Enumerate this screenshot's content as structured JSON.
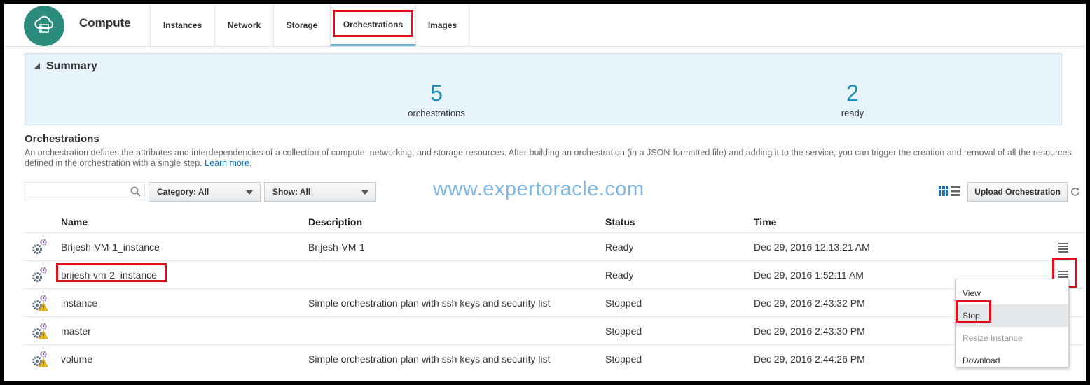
{
  "app": {
    "title": "Compute",
    "brand_color": "#2b8c7e"
  },
  "tabs": [
    {
      "label": "Instances"
    },
    {
      "label": "Network"
    },
    {
      "label": "Storage"
    },
    {
      "label": "Orchestrations",
      "active": true
    },
    {
      "label": "Images"
    }
  ],
  "summary": {
    "title": "Summary",
    "stats": [
      {
        "value": "5",
        "label": "orchestrations"
      },
      {
        "value": "2",
        "label": "ready"
      }
    ]
  },
  "section": {
    "title": "Orchestrations",
    "description": "An orchestration defines the attributes and interdependencies of a collection of compute, networking, and storage resources. After building an orchestration (in a JSON-formatted file) and adding it to the service, you can trigger the creation and removal of all the resources defined in the orchestration with a single step.",
    "learn_more": "Learn more."
  },
  "toolbar": {
    "search_value": "",
    "category_select": "Category: All",
    "show_select": "Show: All",
    "upload_label": "Upload Orchestration"
  },
  "watermark": "www.expertoracle.com",
  "table": {
    "columns": [
      "Name",
      "Description",
      "Status",
      "Time"
    ],
    "rows": [
      {
        "name": "Brijesh-VM-1_instance",
        "description": "Brijesh-VM-1",
        "status": "Ready",
        "time": "Dec 29, 2016 12:13:21 AM",
        "icon": "gears-icon"
      },
      {
        "name": "brijesh-vm-2_instance",
        "description": "",
        "status": "Ready",
        "time": "Dec 29, 2016 1:52:11 AM",
        "icon": "gears-icon"
      },
      {
        "name": "instance",
        "description": "Simple orchestration plan with ssh keys and security list",
        "status": "Stopped",
        "time": "Dec 29, 2016 2:43:32 PM",
        "icon": "gears-warning-icon"
      },
      {
        "name": "master",
        "description": "",
        "status": "Stopped",
        "time": "Dec 29, 2016 2:43:30 PM",
        "icon": "gears-warning-icon"
      },
      {
        "name": "volume",
        "description": "Simple orchestration plan with ssh keys and security list",
        "status": "Stopped",
        "time": "Dec 29, 2016 2:44:26 PM",
        "icon": "gears-warning-icon"
      }
    ]
  },
  "context_menu": {
    "items": [
      {
        "label": "View"
      },
      {
        "label": "Stop",
        "highlighted": true
      },
      {
        "label": "Resize Instance",
        "disabled": true
      },
      {
        "label": "Download"
      }
    ]
  },
  "colors": {
    "accent": "#1f8fb7",
    "highlight": "#e0101a",
    "link": "#0572ce"
  }
}
